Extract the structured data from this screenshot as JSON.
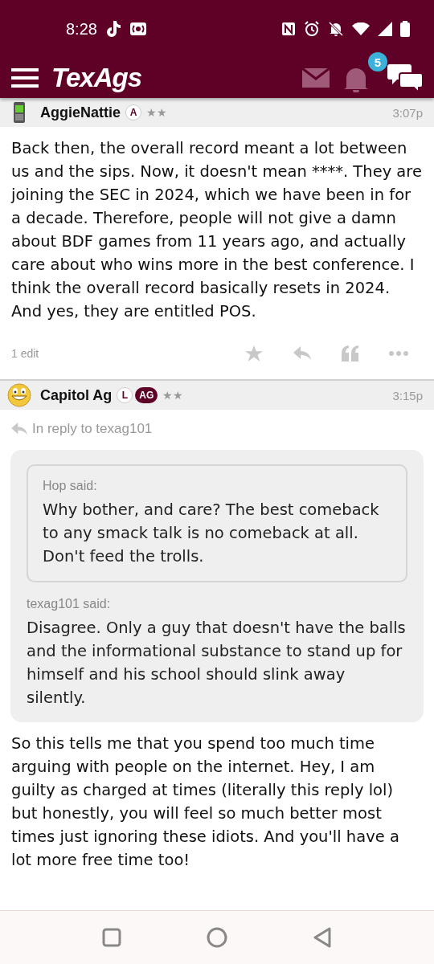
{
  "status_bar": {
    "time": "8:28"
  },
  "app_bar": {
    "logo": "TexAgs",
    "notification_count": "5"
  },
  "posts": [
    {
      "author": "AggieNattie",
      "avatar": {
        "kind": "phone"
      },
      "badges": [
        {
          "text": "A",
          "kind": "outline"
        }
      ],
      "rank": "★★",
      "time": "3:07p",
      "body": "Back then, the overall record meant a lot between us and the sips. Now, it doesn't mean ****. They are joining the SEC in 2024, which we have been in for a decade. Therefore, people will not give a damn about BDF games from 11 years ago, and actually care about who wins more in the best conference. I think the overall record basically resets in 2024. And yes, they are entitled POS.",
      "edits": "1 edit"
    },
    {
      "author": "Capitol Ag",
      "avatar": {
        "kind": "smiley"
      },
      "badges": [
        {
          "text": "L",
          "kind": "outline"
        },
        {
          "text": "AG",
          "kind": "filled"
        }
      ],
      "rank": "★★",
      "time": "3:15p",
      "reply_to": "In reply to texag101",
      "quote": {
        "inner_quote": {
          "author": "Hop said:",
          "text": "Why bother, and care? The best comeback to any smack talk is no comeback at all. Don't feed the trolls."
        },
        "author": "texag101 said:",
        "text": "Disagree. Only a guy that doesn't have the balls and the informational substance to stand up for himself and his school should slink away silently."
      },
      "body": "So this tells me that you spend too much time arguing with people on the internet. Hey, I am guilty as charged at times (literally this reply lol) but honestly, you will feel so much better most times just ignoring these idiots. And you'll have a lot more free time too!"
    }
  ]
}
